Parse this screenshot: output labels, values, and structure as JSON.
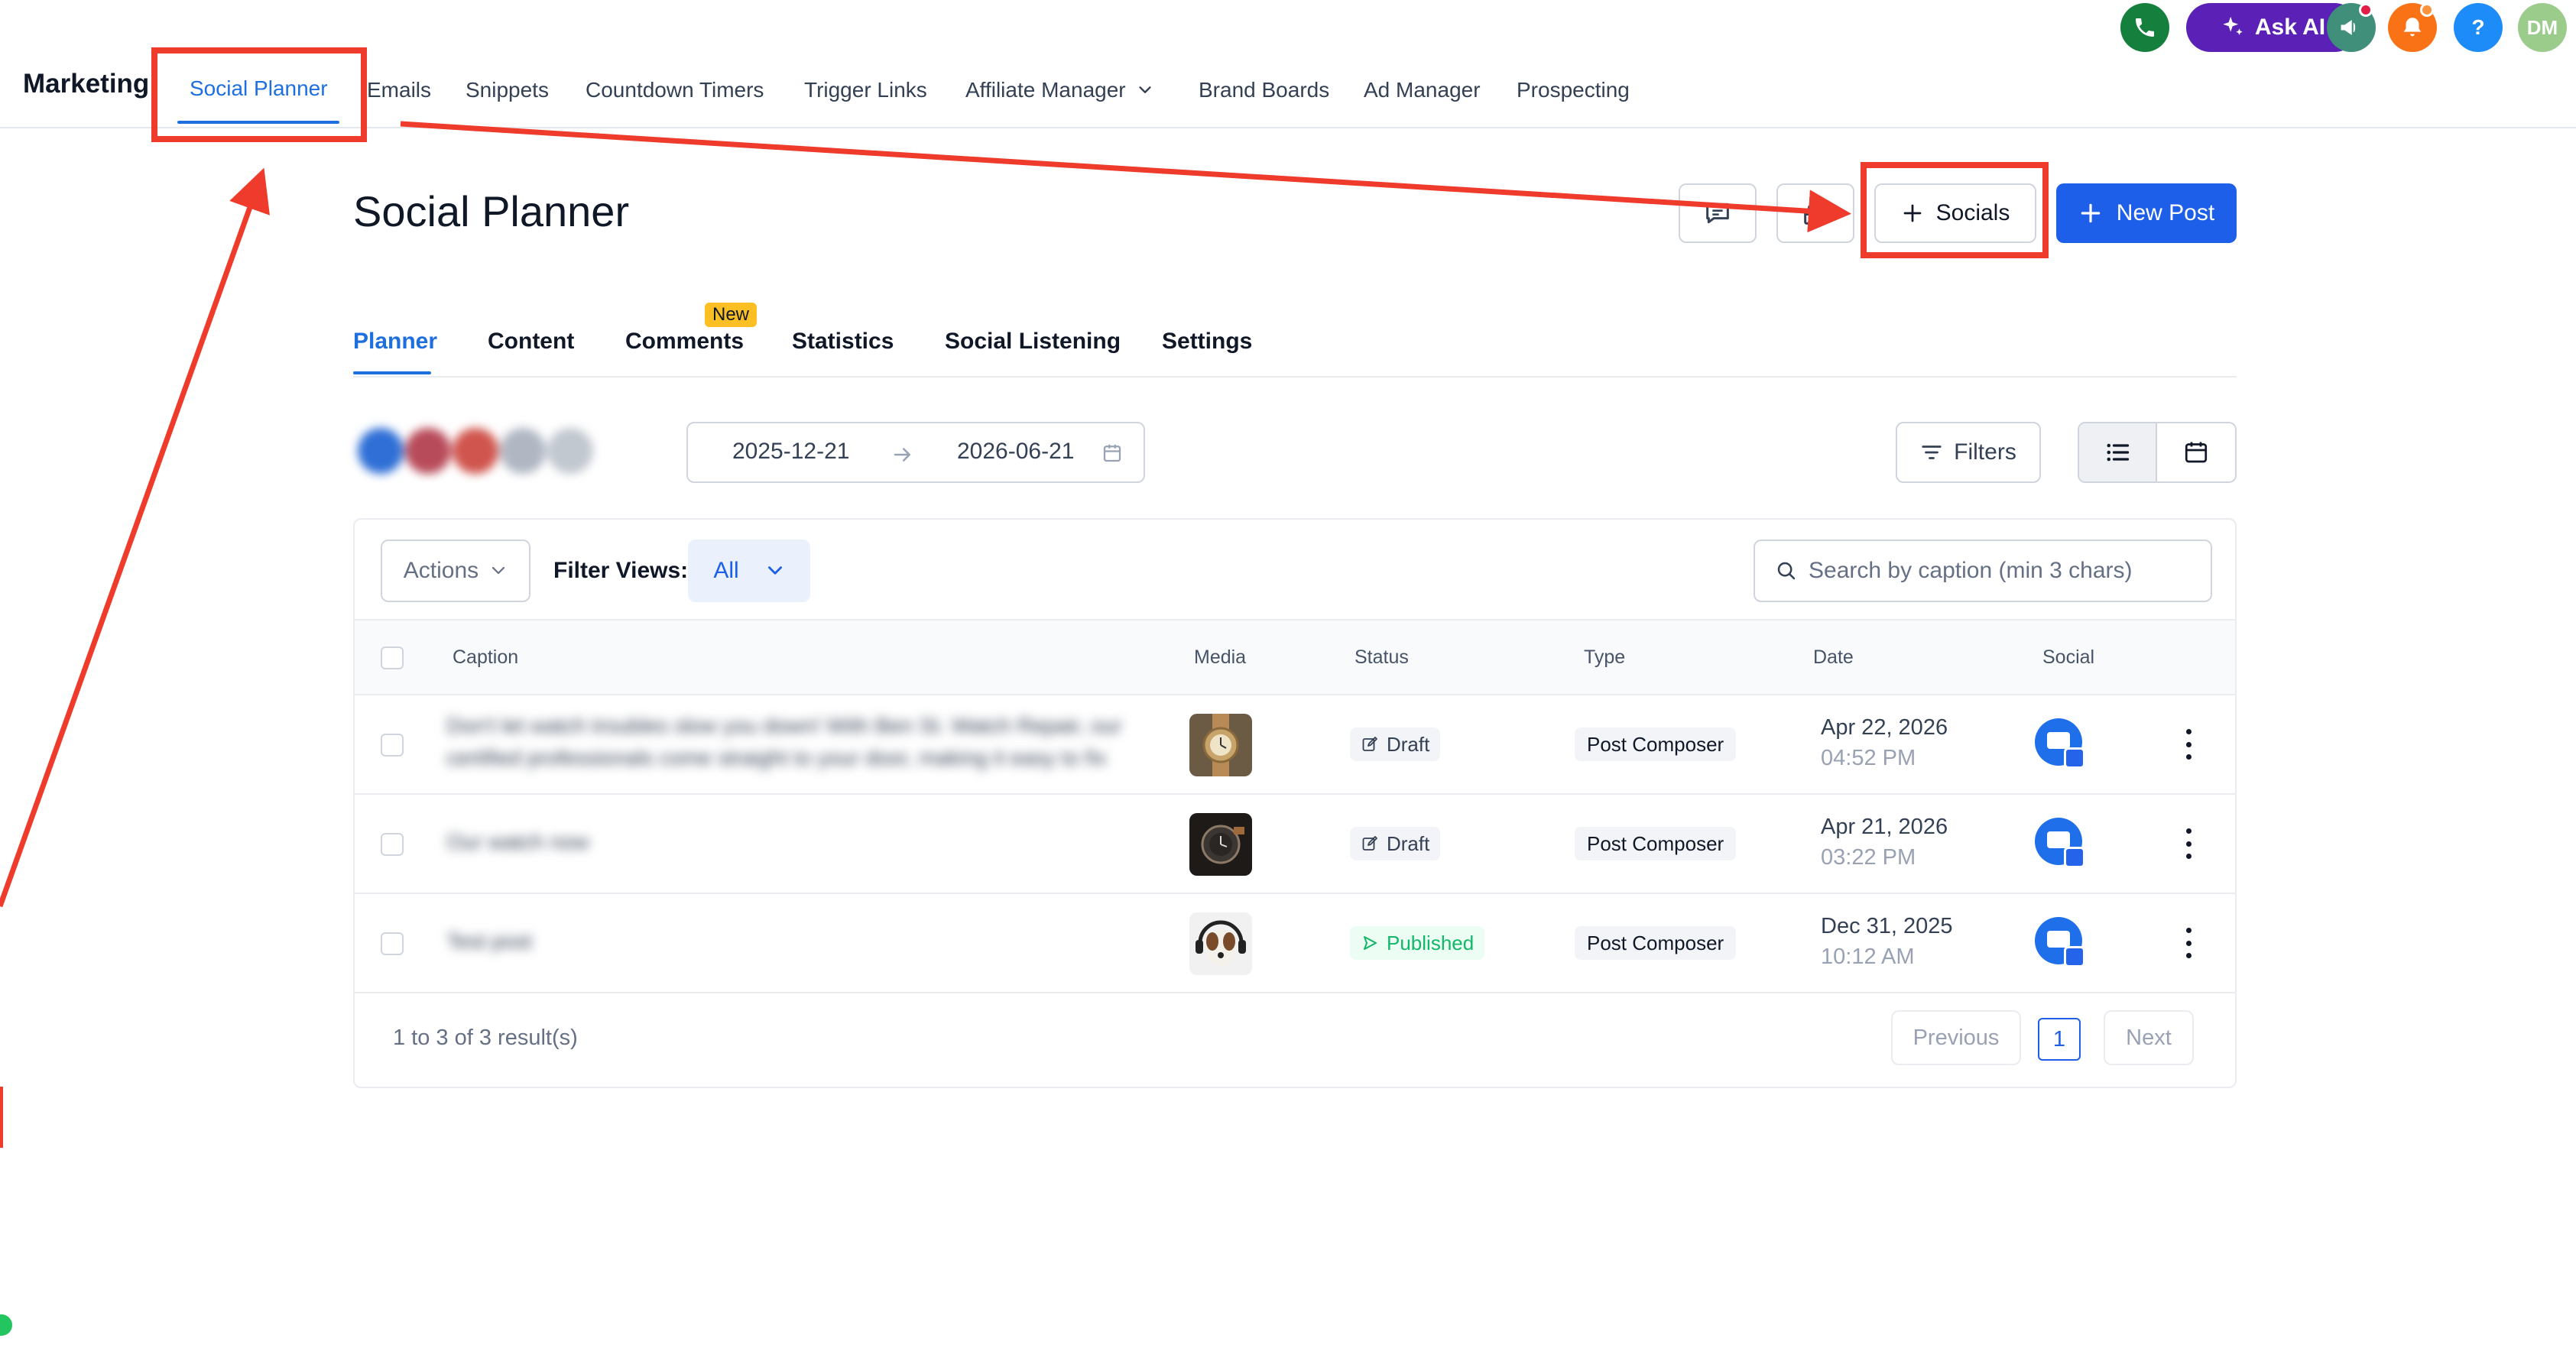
{
  "app": {
    "title": "Marketing"
  },
  "nav": {
    "items": [
      {
        "label": "Social Planner",
        "active": true
      },
      {
        "label": "Emails"
      },
      {
        "label": "Snippets"
      },
      {
        "label": "Countdown Timers"
      },
      {
        "label": "Trigger Links"
      },
      {
        "label": "Affiliate Manager",
        "has_dropdown": true
      },
      {
        "label": "Brand Boards"
      },
      {
        "label": "Ad Manager"
      },
      {
        "label": "Prospecting"
      }
    ]
  },
  "top_actions": {
    "ask_ai_label": "Ask AI",
    "help_label": "?",
    "avatar_initials": "DM",
    "icons": [
      "phone-icon",
      "sparkle-icon",
      "megaphone-icon",
      "bell-icon",
      "help-icon"
    ]
  },
  "page": {
    "title": "Social Planner",
    "socials_label": "Socials",
    "new_post_label": "New Post"
  },
  "tabs": {
    "items": [
      {
        "label": "Planner",
        "active": true
      },
      {
        "label": "Content"
      },
      {
        "label": "Comments",
        "badge": "New"
      },
      {
        "label": "Statistics"
      },
      {
        "label": "Social Listening"
      },
      {
        "label": "Settings"
      }
    ]
  },
  "controls": {
    "date_start": "2025-12-21",
    "date_end": "2026-06-21",
    "filters_label": "Filters",
    "view_mode": "list"
  },
  "table": {
    "actions_label": "Actions",
    "filter_views_label": "Filter Views:",
    "filter_views_value": "All",
    "search_placeholder": "Search by caption (min 3 chars)",
    "columns": [
      "Caption",
      "Media",
      "Status",
      "Type",
      "Date",
      "Social"
    ],
    "rows": [
      {
        "caption_line1": "Don't let watch troubles slow you down! With Ben St. Watch Repair, our",
        "caption_line2": "certified professionals come straight to your door, making it easy to fix",
        "media": "gold-watch",
        "status": "Draft",
        "type": "Post Composer",
        "date": "Apr 22, 2026",
        "time": "04:52 PM"
      },
      {
        "caption_line1": "Our watch now",
        "caption_line2": "",
        "media": "dark-watch",
        "status": "Draft",
        "type": "Post Composer",
        "date": "Apr 21, 2026",
        "time": "03:22 PM"
      },
      {
        "caption_line1": "Test post",
        "caption_line2": "",
        "media": "dog-headphones",
        "status": "Published",
        "type": "Post Composer",
        "date": "Dec 31, 2025",
        "time": "10:12 AM"
      }
    ],
    "result_text": "1 to 3 of 3 result(s)",
    "pagination": {
      "previous_label": "Previous",
      "page": "1",
      "next_label": "Next"
    }
  },
  "colors": {
    "accent": "#1d5fe8",
    "annotation": "#ef3b2c",
    "ask_ai": "#5b21b6",
    "published": "#12b76a"
  }
}
